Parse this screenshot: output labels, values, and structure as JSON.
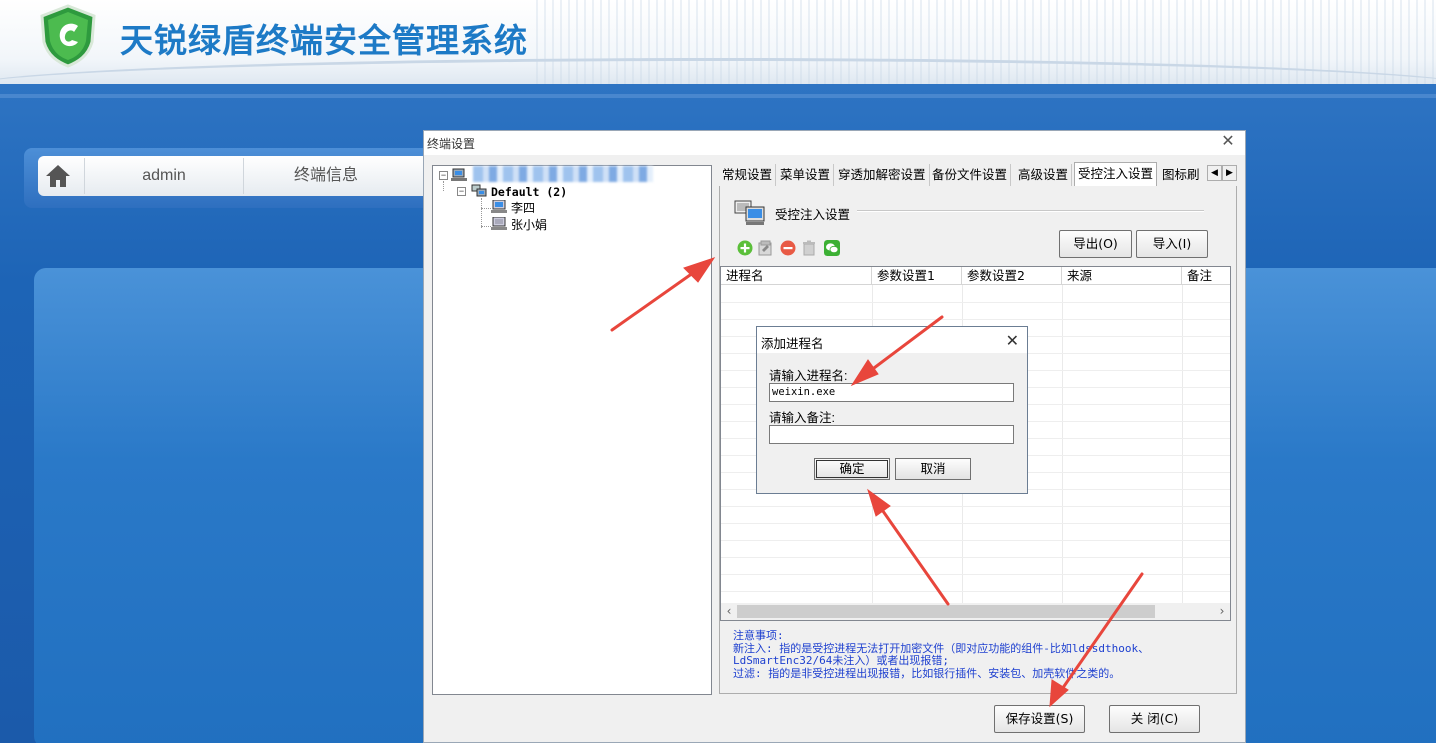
{
  "app": {
    "title": "天锐绿盾终端安全管理系统",
    "nav": {
      "admin": "admin",
      "terminal_info": "终端信息"
    }
  },
  "dialog": {
    "title": "终端设置",
    "tree": {
      "group_label": "Default (2)",
      "computers": [
        "李四",
        "张小娟"
      ]
    },
    "tabs": [
      "常规设置",
      "菜单设置",
      "穿透加解密设置",
      "备份文件设置",
      "高级设置",
      "受控注入设置",
      "图标刷"
    ],
    "active_tab": "受控注入设置",
    "section_title": "受控注入设置",
    "export_button": "导出(O)",
    "import_button": "导入(I)",
    "grid_columns": [
      "进程名",
      "参数设置1",
      "参数设置2",
      "来源",
      "备注"
    ],
    "notes": [
      "注意事项:",
      "新注入: 指的是受控进程无法打开加密文件（即对应功能的组件-比如ldssdthook、",
      "LdSmartEnc32/64未注入）或者出现报错;",
      "过滤: 指的是非受控进程出现报错，比如银行插件、安装包、加壳软件之类的。"
    ],
    "save_button": "保存设置(S)",
    "close_button": "关 闭(C)"
  },
  "popup": {
    "title": "添加进程名",
    "process_label": "请输入进程名:",
    "process_value": "weixin.exe",
    "remark_label": "请输入备注:",
    "remark_value": "",
    "ok_button": "确定",
    "cancel_button": "取消"
  },
  "colors": {
    "title_blue": "#1d7ac6",
    "note_blue": "#1d3fcf",
    "arrow_red": "#e8463c"
  }
}
